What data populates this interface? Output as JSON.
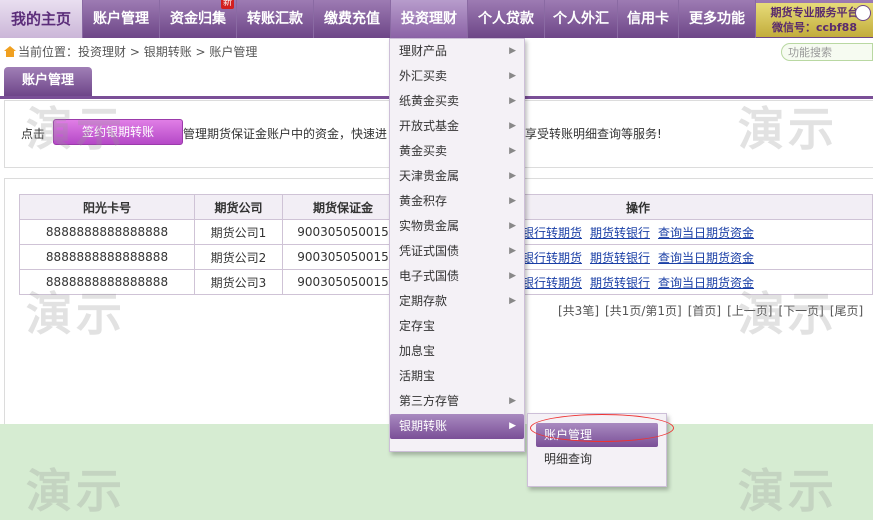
{
  "nav": {
    "home": "我的主页",
    "items": [
      "账户管理",
      "资金归集",
      "转账汇款",
      "缴费充值",
      "投资理财",
      "个人贷款",
      "个人外汇",
      "信用卡",
      "更多功能"
    ],
    "new_badge": "新",
    "promo_line1": "期货专业服务平台",
    "promo_line2": "微信号：ccbf88"
  },
  "breadcrumb": {
    "prefix": "当前位置：",
    "items": [
      "投资理财",
      "银期转账",
      "账户管理"
    ],
    "sep": " > "
  },
  "search": {
    "placeholder": "功能搜索"
  },
  "tab": {
    "label": "账户管理"
  },
  "intro": {
    "prefix": "点击",
    "button": "签约银期转账",
    "middle": "管理期货保证金账户中的资金，快速进",
    "tail": "享受转账明细查询等服务!"
  },
  "table": {
    "headers": [
      "阳光卡号",
      "期货公司",
      "期货保证金",
      "操作"
    ],
    "rows": [
      {
        "card": "8888888888888888",
        "company": "期货公司1",
        "account": "900305050015"
      },
      {
        "card": "8888888888888888",
        "company": "期货公司2",
        "account": "900305050015"
      },
      {
        "card": "8888888888888888",
        "company": "期货公司3",
        "account": "900305050015"
      }
    ],
    "ops": [
      "银行转期货",
      "期货转银行",
      "查询当日期货资金"
    ]
  },
  "pager": [
    "[共3笔]",
    "[共1页/第1页]",
    "[首页]",
    "[上一页]",
    "[下一页]",
    "[尾页]"
  ],
  "watermark": "演示",
  "dropdown": {
    "items": [
      {
        "label": "理财产品",
        "arrow": true
      },
      {
        "label": "外汇买卖",
        "arrow": true
      },
      {
        "label": "纸黄金买卖",
        "arrow": true
      },
      {
        "label": "开放式基金",
        "arrow": true
      },
      {
        "label": "黄金买卖",
        "arrow": true
      },
      {
        "label": "天津贵金属",
        "arrow": true
      },
      {
        "label": "黄金积存",
        "arrow": true
      },
      {
        "label": "实物贵金属",
        "arrow": true
      },
      {
        "label": "凭证式国债",
        "arrow": true
      },
      {
        "label": "电子式国债",
        "arrow": true
      },
      {
        "label": "定期存款",
        "arrow": true
      },
      {
        "label": "定存宝",
        "arrow": false
      },
      {
        "label": "加息宝",
        "arrow": false
      },
      {
        "label": "活期宝",
        "arrow": false
      },
      {
        "label": "第三方存管",
        "arrow": true
      },
      {
        "label": "银期转账",
        "arrow": true
      }
    ],
    "arrow_glyph": "▶"
  },
  "submenu": {
    "items": [
      "账户管理",
      "明细查询"
    ]
  },
  "colors": {
    "brand": "#7a4f97",
    "link": "#1a3fa6",
    "highlight": "#e33333",
    "bottom_bg": "#d6ecd2"
  }
}
